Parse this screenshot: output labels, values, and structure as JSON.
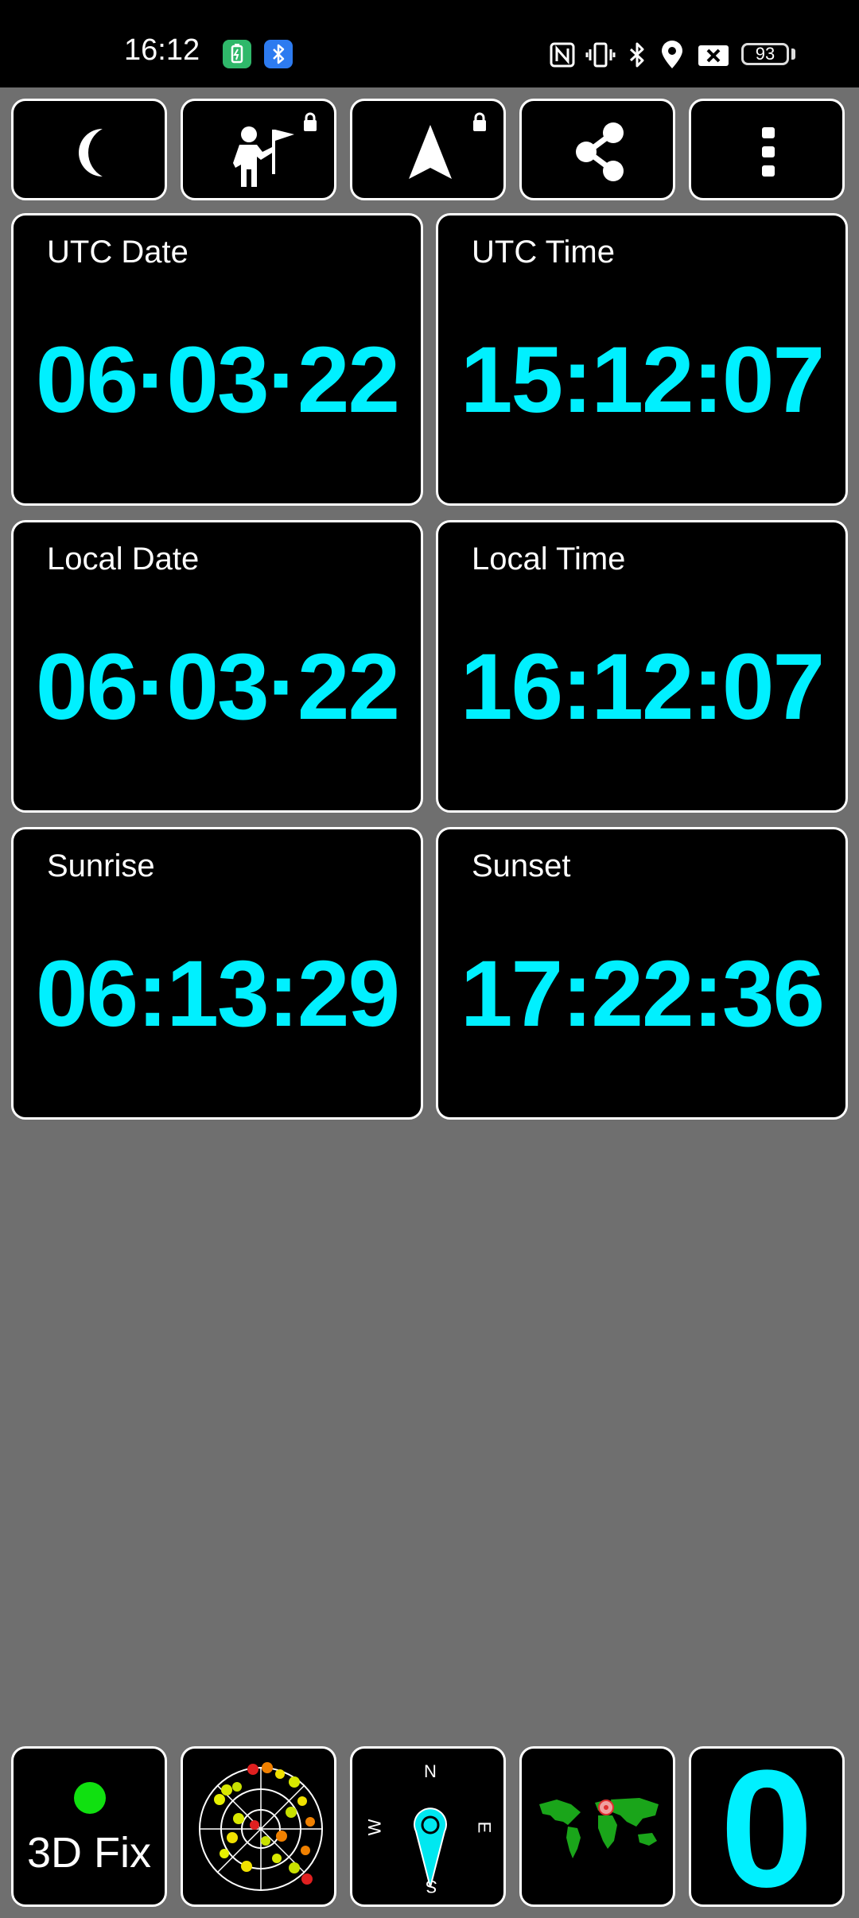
{
  "status_bar": {
    "time": "16:12",
    "battery": "93",
    "icons": [
      "battery-saver-app-icon",
      "bluetooth-app-icon",
      "nfc-icon",
      "vibrate-icon",
      "bluetooth-icon",
      "location-icon",
      "no-sim-icon",
      "battery-icon"
    ]
  },
  "toolbar": {
    "buttons": [
      {
        "icon": "night-mode-moon-icon"
      },
      {
        "icon": "hiker-flag-icon",
        "locked": true
      },
      {
        "icon": "navigation-arrow-icon",
        "locked": true
      },
      {
        "icon": "share-icon"
      },
      {
        "icon": "more-vert-icon"
      }
    ]
  },
  "cards": [
    {
      "label": "UTC Date",
      "value": "06·03·22"
    },
    {
      "label": "UTC Time",
      "value": "15:12:07"
    },
    {
      "label": "Local Date",
      "value": "06·03·22"
    },
    {
      "label": "Local Time",
      "value": "16:12:07"
    },
    {
      "label": "Sunrise",
      "value": "06:13:29"
    },
    {
      "label": "Sunset",
      "value": "17:22:36"
    }
  ],
  "bottom_bar": {
    "fix_status": "3D Fix",
    "fix_color": "#10e010",
    "compass": {
      "n": "N",
      "s": "S",
      "e": "E",
      "w": "W"
    },
    "count": "0"
  },
  "colors": {
    "accent": "#00f0ff",
    "background": "#6f6f6f",
    "panel": "#000000",
    "border": "#ffffff"
  }
}
